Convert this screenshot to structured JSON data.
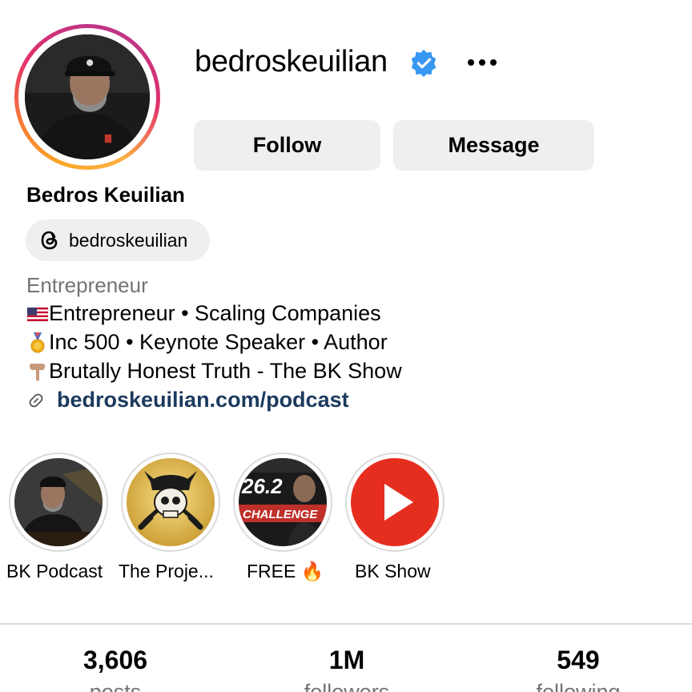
{
  "profile": {
    "username": "bedroskeuilian",
    "display_name": "Bedros Keuilian",
    "threads_handle": "bedroskeuilian",
    "category": "Entrepreneur",
    "bio": [
      {
        "emoji": "flag-us",
        "text": "Entrepreneur • Scaling Companies"
      },
      {
        "emoji": "medal",
        "text": "Inc 500 • Keynote Speaker • Author"
      },
      {
        "emoji": "pointing-down",
        "text": "Brutally Honest Truth - The BK Show"
      }
    ],
    "link": "bedroskeuilian.com/podcast"
  },
  "actions": {
    "follow_label": "Follow",
    "message_label": "Message"
  },
  "highlights": [
    {
      "label": "BK Podcast"
    },
    {
      "label": "The Proje..."
    },
    {
      "label": "FREE 🔥"
    },
    {
      "label": "BK Show"
    }
  ],
  "highlight_art": {
    "challenge_number": "26.2",
    "challenge_text": "CHALLENGE"
  },
  "stats": [
    {
      "value": "3,606",
      "label": "posts"
    },
    {
      "value": "1M",
      "label": "followers"
    },
    {
      "value": "549",
      "label": "following"
    }
  ],
  "colors": {
    "verified_blue": "#3897f0",
    "link_color": "#1c3a5e",
    "button_bg": "#efefef",
    "muted_text": "#737373",
    "youtube_red": "#e62e1f"
  }
}
